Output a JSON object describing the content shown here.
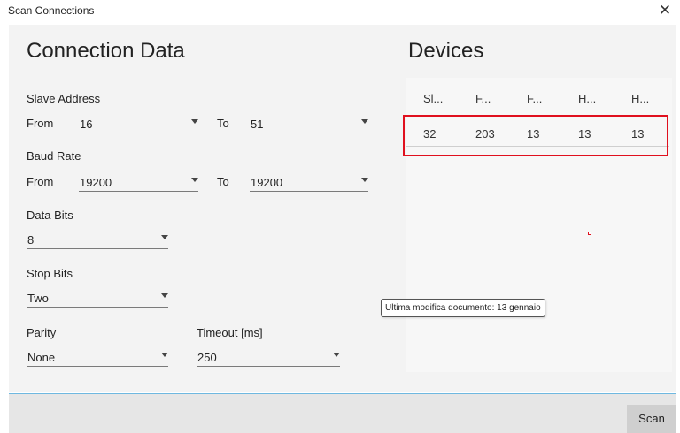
{
  "window": {
    "title": "Scan Connections",
    "close_glyph": "✕"
  },
  "connection": {
    "heading": "Connection Data",
    "slave_address": {
      "label": "Slave Address",
      "from_label": "From",
      "from_value": "16",
      "to_label": "To",
      "to_value": "51"
    },
    "baud_rate": {
      "label": "Baud Rate",
      "from_label": "From",
      "from_value": "19200",
      "to_label": "To",
      "to_value": "19200"
    },
    "data_bits": {
      "label": "Data Bits",
      "value": "8"
    },
    "stop_bits": {
      "label": "Stop Bits",
      "value": "Two"
    },
    "parity": {
      "label": "Parity",
      "value": "None"
    },
    "timeout": {
      "label": "Timeout [ms]",
      "value": "250"
    }
  },
  "devices": {
    "heading": "Devices",
    "columns": [
      "Sl...",
      "F...",
      "F...",
      "H...",
      "H..."
    ],
    "rows": [
      [
        "32",
        "203",
        "13",
        "13",
        "13"
      ]
    ]
  },
  "tooltip": {
    "text": "Ultima modifica documento: 13 gennaio"
  },
  "footer": {
    "scan_label": "Scan"
  },
  "colors": {
    "highlight": "#e0101e",
    "accent_line": "#6fb8e0",
    "panel_bg": "#f3f3f3"
  },
  "icons": {
    "close": "close-icon",
    "dropdown": "chevron-down-icon"
  }
}
